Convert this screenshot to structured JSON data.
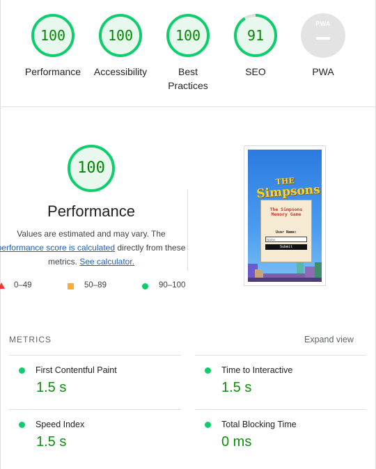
{
  "summary": {
    "categories": [
      {
        "label_line1": "Performance",
        "label_line2": "",
        "score": 100
      },
      {
        "label_line1": "Accessibility",
        "label_line2": "",
        "score": 100
      },
      {
        "label_line1": "Best",
        "label_line2": "Practices",
        "score": 100
      },
      {
        "label_line1": "SEO",
        "label_line2": "",
        "score": 91
      }
    ],
    "pwa": {
      "badge_text": "PWA",
      "label": "PWA"
    }
  },
  "performance": {
    "score": "100",
    "title": "Performance",
    "desc_line1": "Values are estimated and may vary. The",
    "desc_link1": "performance score is calculated",
    "desc_mid": " directly from these",
    "desc_line3_pre": "metrics. ",
    "desc_link2": "See calculator.",
    "legend": {
      "fail": "0–49",
      "average": "50–89",
      "pass": "90–100"
    }
  },
  "screenshot": {
    "logo_line1": "THE",
    "logo_line2": "Simpsons",
    "card_title": "The Simpsons Memory Game",
    "user_label": "User Name:",
    "input_placeholder": "Name",
    "submit_label": "Submit"
  },
  "metrics": {
    "header": "METRICS",
    "expand_label": "Expand view",
    "items": [
      {
        "label": "First Contentful Paint",
        "value": "1.5 s"
      },
      {
        "label": "Time to Interactive",
        "value": "1.5 s"
      },
      {
        "label": "Speed Index",
        "value": "1.5 s"
      },
      {
        "label": "Total Blocking Time",
        "value": "0 ms"
      }
    ]
  },
  "colors": {
    "pass": "#0cce6b",
    "pass_fill": "#e8f8ee",
    "pass_text": "#008800",
    "average": "#ffaa33",
    "fail": "#ff3333"
  }
}
